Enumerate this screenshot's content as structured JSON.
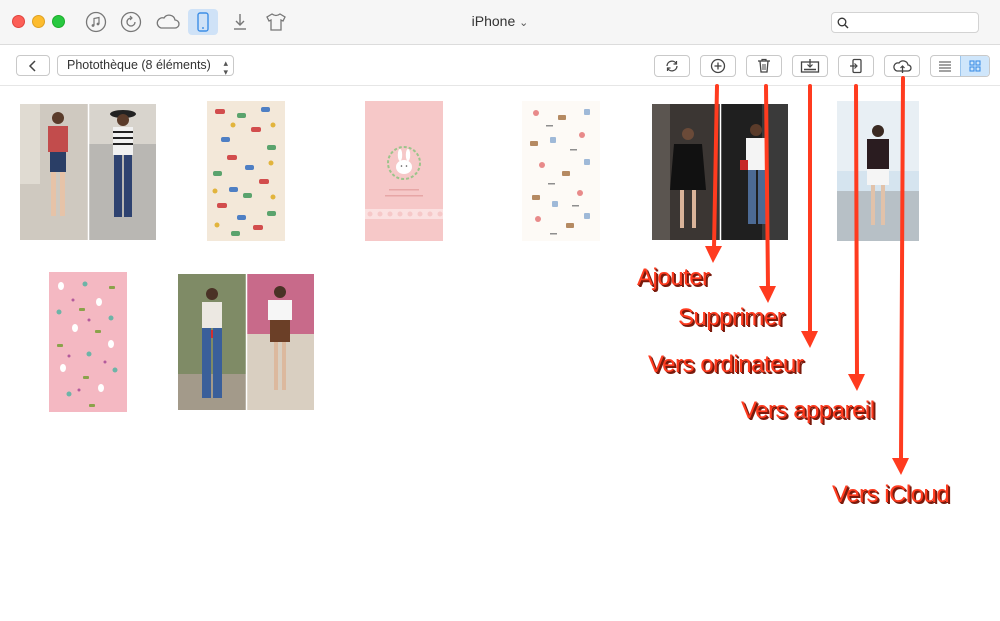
{
  "window": {
    "title": "iPhone",
    "title_chevron": "⌄"
  },
  "titlebar_icons": [
    "music-note-icon",
    "restore-icon",
    "cloud-icon",
    "phone-icon",
    "download-icon",
    "tshirt-icon"
  ],
  "toolbar": {
    "album_selector": "Photothèque (8 éléments)",
    "buttons": [
      "refresh",
      "add",
      "delete",
      "to-computer",
      "to-device",
      "to-icloud"
    ]
  },
  "photos": [
    {
      "kind": "street-outfit-collage"
    },
    {
      "kind": "patterned-wallpaper"
    },
    {
      "kind": "pink-bunny-wallpaper"
    },
    {
      "kind": "sweets-wallpaper"
    },
    {
      "kind": "street-outfit-collage"
    },
    {
      "kind": "street-outfit-single"
    },
    {
      "kind": "pink-bunny-pattern"
    },
    {
      "kind": "street-outfit-collage"
    }
  ],
  "annotations": {
    "ajouter": "Ajouter",
    "supprimer": "Supprimer",
    "vers_ordinateur": "Vers ordinateur",
    "vers_appareil": "Vers appareil",
    "vers_icloud": "Vers iCloud"
  },
  "colors": {
    "annotation": "#ff3b1f",
    "accent": "#3d8ee6",
    "active_tab": "#cfe2f7"
  }
}
